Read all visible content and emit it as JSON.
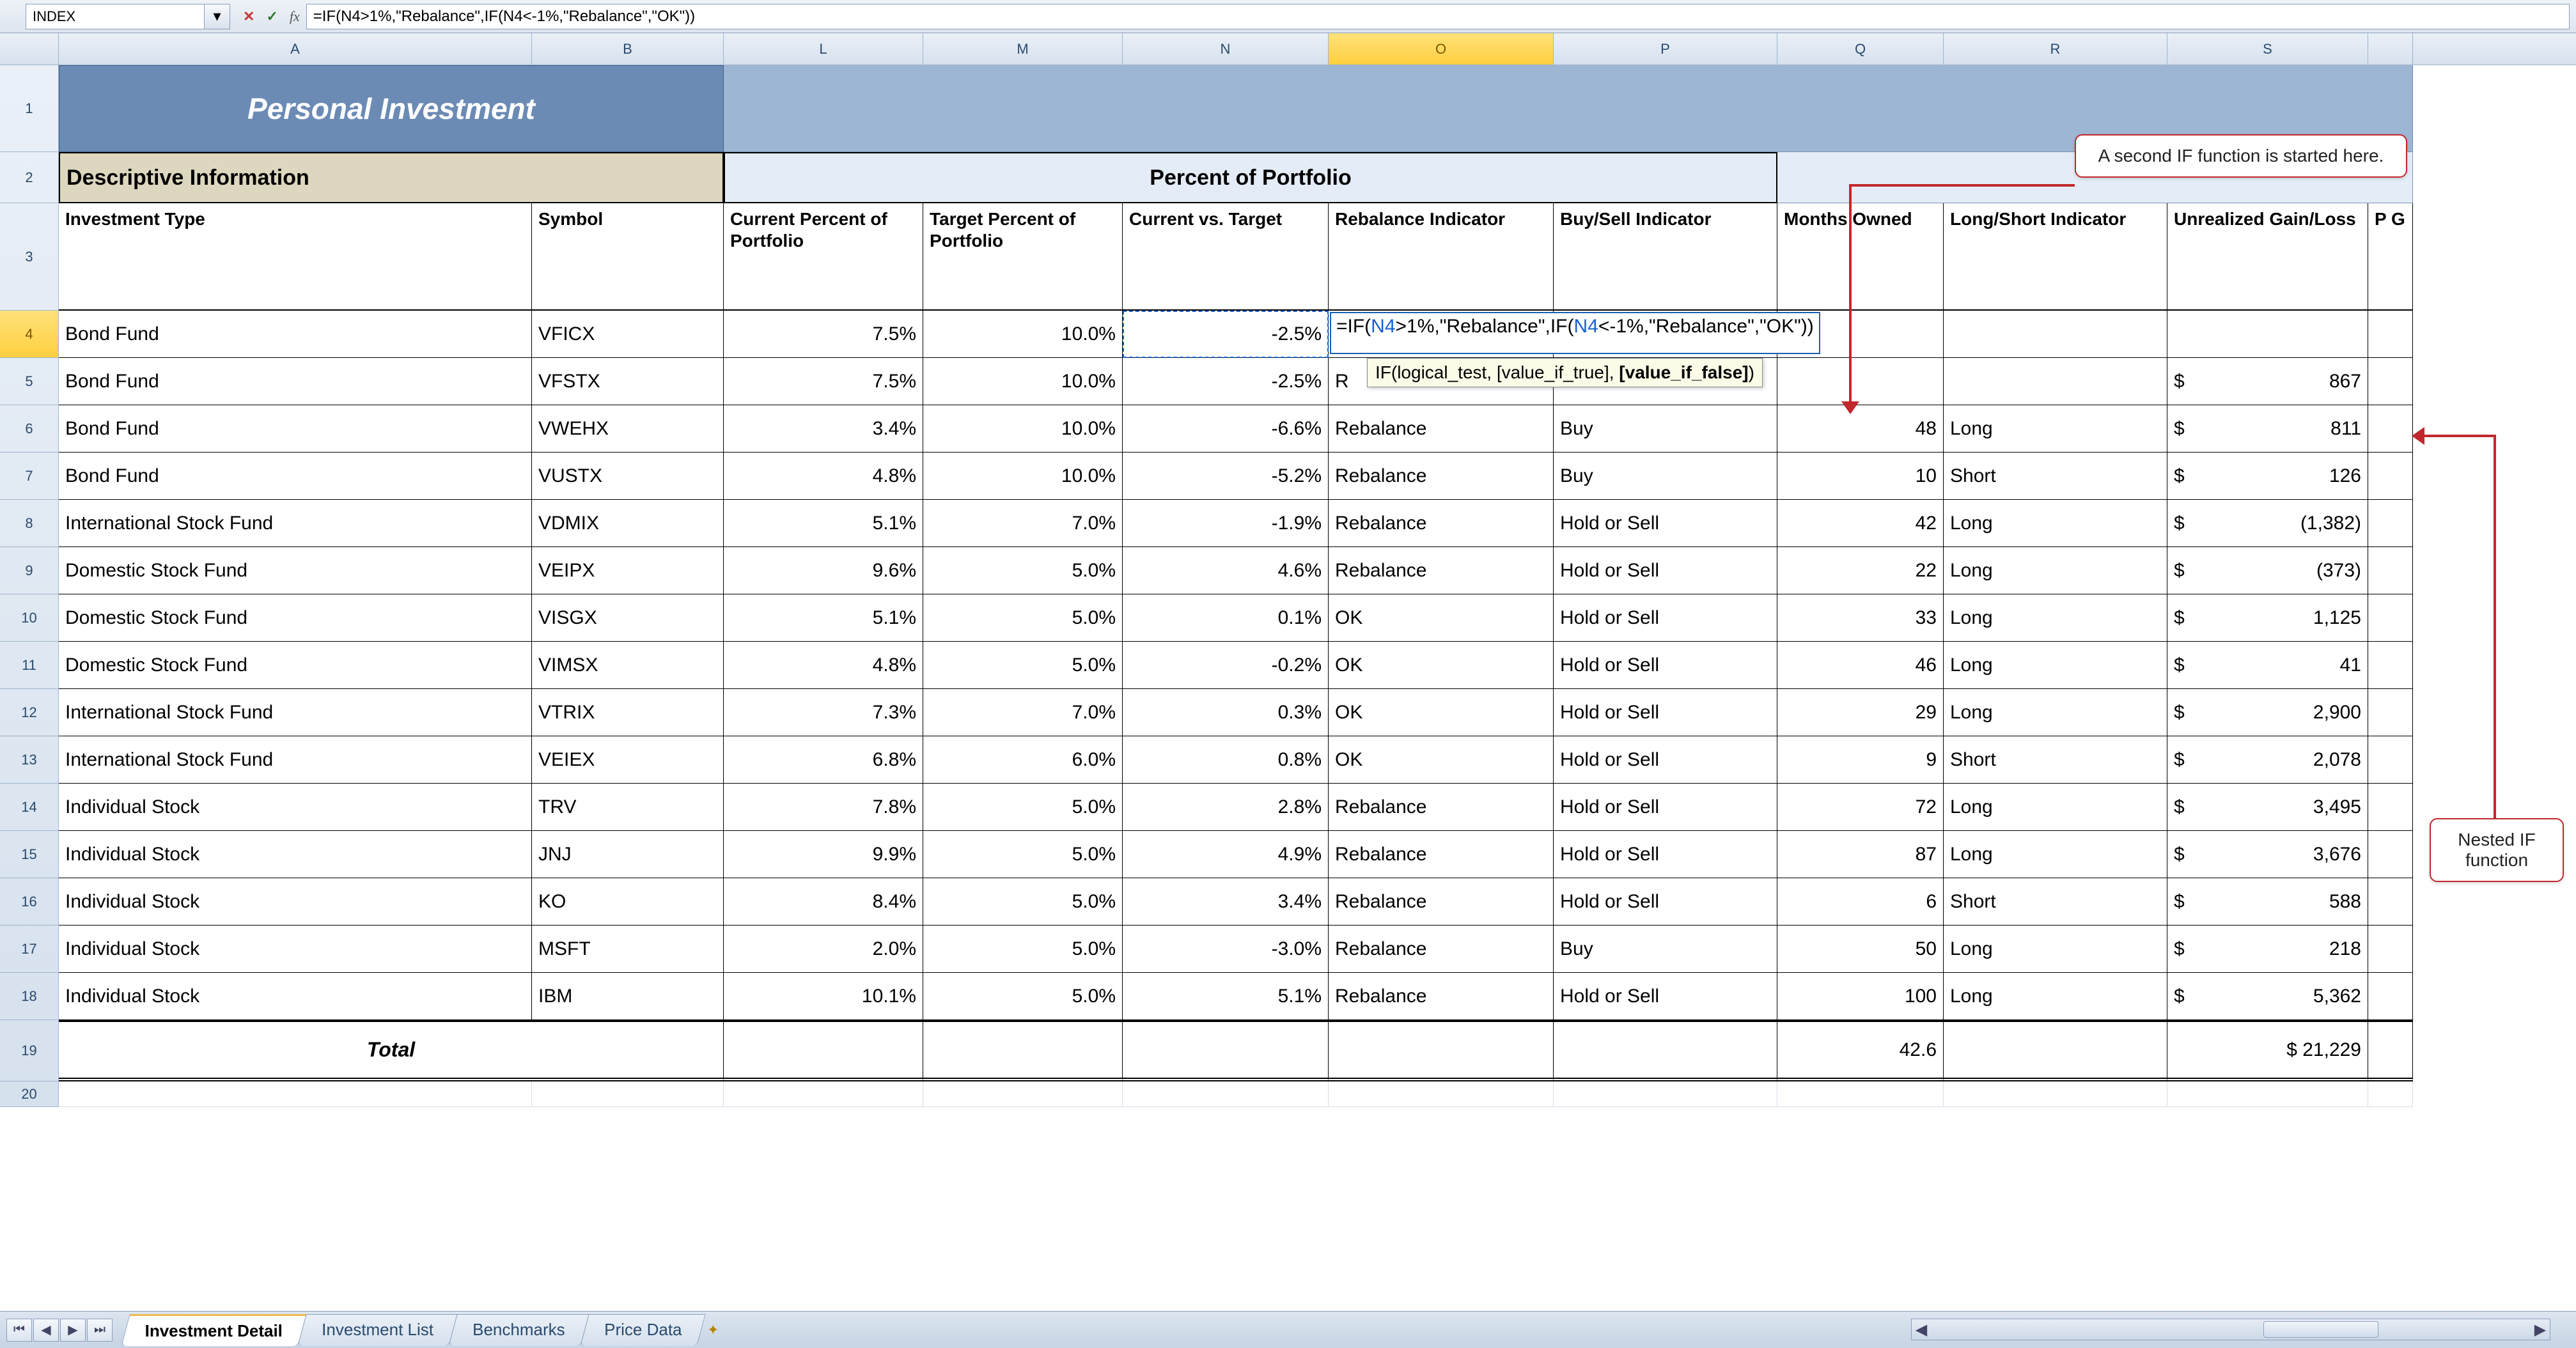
{
  "formula_bar": {
    "name_box": "INDEX",
    "formula": "=IF(N4>1%,\"Rebalance\",IF(N4<-1%,\"Rebalance\",\"OK\"))",
    "fx_label": "fx"
  },
  "column_letters": [
    "A",
    "B",
    "L",
    "M",
    "N",
    "O",
    "P",
    "Q",
    "R",
    "S"
  ],
  "active_column_index": 5,
  "row_numbers": [
    "1",
    "2",
    "3",
    "4",
    "5",
    "6",
    "7",
    "8",
    "9",
    "10",
    "11",
    "12",
    "13",
    "14",
    "15",
    "16",
    "17",
    "18",
    "19",
    "20"
  ],
  "active_row_index": 3,
  "title": "Personal Investment",
  "section_left": "Descriptive Information",
  "section_right": "Percent of Portfolio",
  "headers": {
    "A": "Investment Type",
    "B": "Symbol",
    "L": "Current Percent of Portfolio",
    "M": "Target Percent of Portfolio",
    "N": "Current vs. Target",
    "O": "Rebalance Indicator",
    "P": "Buy/Sell Indicator",
    "Q": "Months Owned",
    "R": "Long/Short Indicator",
    "S": "Unrealized Gain/Loss",
    "T": "P G"
  },
  "rows": [
    {
      "r": 4,
      "type": "Bond Fund",
      "sym": "VFICX",
      "L": "7.5%",
      "M": "10.0%",
      "N": "-2.5%",
      "O_formula": true
    },
    {
      "r": 5,
      "type": "Bond Fund",
      "sym": "VFSTX",
      "L": "7.5%",
      "M": "10.0%",
      "N": "-2.5%",
      "O": "R",
      "S": "867"
    },
    {
      "r": 6,
      "type": "Bond Fund",
      "sym": "VWEHX",
      "L": "3.4%",
      "M": "10.0%",
      "N": "-6.6%",
      "O": "Rebalance",
      "P": "Buy",
      "Q": "48",
      "R": "Long",
      "S": "811"
    },
    {
      "r": 7,
      "type": "Bond Fund",
      "sym": "VUSTX",
      "L": "4.8%",
      "M": "10.0%",
      "N": "-5.2%",
      "O": "Rebalance",
      "P": "Buy",
      "Q": "10",
      "R": "Short",
      "S": "126"
    },
    {
      "r": 8,
      "type": "International Stock Fund",
      "sym": "VDMIX",
      "L": "5.1%",
      "M": "7.0%",
      "N": "-1.9%",
      "O": "Rebalance",
      "P": "Hold or Sell",
      "Q": "42",
      "R": "Long",
      "S": "(1,382)"
    },
    {
      "r": 9,
      "type": "Domestic Stock Fund",
      "sym": "VEIPX",
      "L": "9.6%",
      "M": "5.0%",
      "N": "4.6%",
      "O": "Rebalance",
      "P": "Hold or Sell",
      "Q": "22",
      "R": "Long",
      "S": "(373)"
    },
    {
      "r": 10,
      "type": "Domestic Stock Fund",
      "sym": "VISGX",
      "L": "5.1%",
      "M": "5.0%",
      "N": "0.1%",
      "O": "OK",
      "P": "Hold or Sell",
      "Q": "33",
      "R": "Long",
      "S": "1,125"
    },
    {
      "r": 11,
      "type": "Domestic Stock Fund",
      "sym": "VIMSX",
      "L": "4.8%",
      "M": "5.0%",
      "N": "-0.2%",
      "O": "OK",
      "P": "Hold or Sell",
      "Q": "46",
      "R": "Long",
      "S": "41"
    },
    {
      "r": 12,
      "type": "International Stock Fund",
      "sym": "VTRIX",
      "L": "7.3%",
      "M": "7.0%",
      "N": "0.3%",
      "O": "OK",
      "P": "Hold or Sell",
      "Q": "29",
      "R": "Long",
      "S": "2,900"
    },
    {
      "r": 13,
      "type": "International Stock Fund",
      "sym": "VEIEX",
      "L": "6.8%",
      "M": "6.0%",
      "N": "0.8%",
      "O": "OK",
      "P": "Hold or Sell",
      "Q": "9",
      "R": "Short",
      "S": "2,078"
    },
    {
      "r": 14,
      "type": "Individual Stock",
      "sym": "TRV",
      "L": "7.8%",
      "M": "5.0%",
      "N": "2.8%",
      "O": "Rebalance",
      "P": "Hold or Sell",
      "Q": "72",
      "R": "Long",
      "S": "3,495"
    },
    {
      "r": 15,
      "type": "Individual Stock",
      "sym": "JNJ",
      "L": "9.9%",
      "M": "5.0%",
      "N": "4.9%",
      "O": "Rebalance",
      "P": "Hold or Sell",
      "Q": "87",
      "R": "Long",
      "S": "3,676"
    },
    {
      "r": 16,
      "type": "Individual Stock",
      "sym": "KO",
      "L": "8.4%",
      "M": "5.0%",
      "N": "3.4%",
      "O": "Rebalance",
      "P": "Hold or Sell",
      "Q": "6",
      "R": "Short",
      "S": "588"
    },
    {
      "r": 17,
      "type": "Individual Stock",
      "sym": "MSFT",
      "L": "2.0%",
      "M": "5.0%",
      "N": "-3.0%",
      "O": "Rebalance",
      "P": "Buy",
      "Q": "50",
      "R": "Long",
      "S": "218"
    },
    {
      "r": 18,
      "type": "Individual Stock",
      "sym": "IBM",
      "L": "10.1%",
      "M": "5.0%",
      "N": "5.1%",
      "O": "Rebalance",
      "P": "Hold or Sell",
      "Q": "100",
      "R": "Long",
      "S": "5,362"
    }
  ],
  "totals": {
    "label": "Total",
    "Q": "42.6",
    "S": "$ 21,229"
  },
  "formula_edit": {
    "pre": "=IF(",
    "ref1": "N4",
    "mid1": ">1%,\"Rebalance\",IF(",
    "ref2": "N4",
    "post": "<-1%,\"Rebalance\",\"OK\"))"
  },
  "tooltip": {
    "sig_pre": "IF(logical_test, [value_if_true], ",
    "sig_bold": "[value_if_false]",
    "sig_post": ")"
  },
  "callouts": {
    "top": "A second IF function is started here.",
    "right_l1": "Nested IF",
    "right_l2": "function"
  },
  "tabs": [
    "Investment Detail",
    "Investment List",
    "Benchmarks",
    "Price Data"
  ],
  "active_tab": 0,
  "col_widths": {
    "A": 740,
    "B": 300,
    "L": 312,
    "M": 312,
    "N": 322,
    "O": 352,
    "P": 350,
    "Q": 260,
    "R": 350,
    "S": 314,
    "T": 70
  },
  "col_lefts": {
    "A": 0,
    "B": 740,
    "L": 1040,
    "M": 1352,
    "N": 1664,
    "O": 1986,
    "P": 2338,
    "Q": 2688,
    "R": 2948,
    "S": 3298,
    "T": 3612
  }
}
